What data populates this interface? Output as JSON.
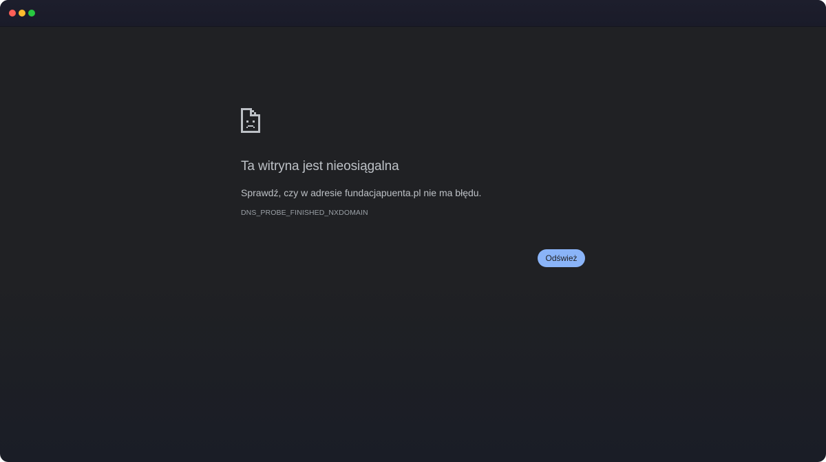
{
  "window": {
    "controls": [
      "close",
      "minimize",
      "maximize"
    ]
  },
  "error_page": {
    "icon": "sad-page-icon",
    "heading": "Ta witryna jest nieosiągalna",
    "message_prefix": "Sprawdź, czy w adresie ",
    "domain": "fundacjapuenta.pl",
    "message_suffix": " nie ma błędu.",
    "error_code": "DNS_PROBE_FINISHED_NXDOMAIN",
    "reload_label": "Odśwież"
  },
  "colors": {
    "background": "#202124",
    "text": "#bdc1c6",
    "secondary_text": "#9aa0a6",
    "button": "#8ab4f8"
  }
}
